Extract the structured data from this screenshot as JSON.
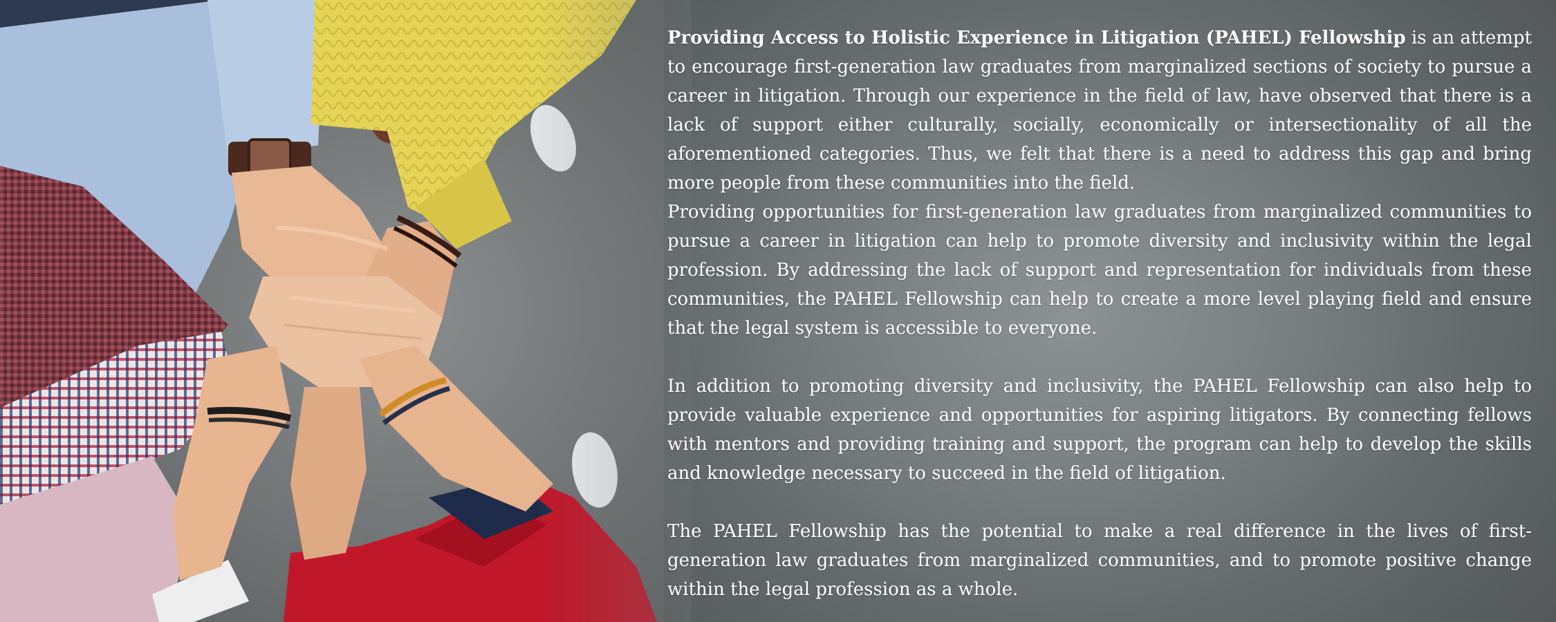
{
  "intro": {
    "title": "Providing Access to Holistic Experience in Litigation (PAHEL) Fellowship",
    "text": " is an attempt to encourage first-generation law graduates from marginalized sections of society to pursue a career in litigation. Through our experience in the field of law, have observed that there is a lack of support either culturally, socially, economically or intersectionality of all the aforementioned categories. Thus, we felt that there is a need to address this gap and bring more people from these communities into the field."
  },
  "paragraph_2": "Providing opportunities for first-generation law graduates from marginalized communities to pursue a career in litigation can help to promote diversity and inclusivity within the legal profession. By addressing the lack of support and representation for individuals from these communities, the PAHEL Fellowship can help to create a more level playing field and ensure that the legal system is accessible to everyone.",
  "paragraph_3": "In addition to promoting diversity and inclusivity, the PAHEL Fellowship can also help to provide valuable experience and opportunities for aspiring litigators. By connecting fellows with mentors and providing training and support, the program can help to develop the skills and knowledge necessary to succeed in the field of litigation.",
  "paragraph_4": "The PAHEL Fellowship has the potential to make a real difference in the lives of first-generation law graduates from marginalized communities, and to promote positive change within the legal profession as a whole.",
  "colors": {
    "text": "#ffffff",
    "background": "#7a7f81",
    "yellow_sleeve": "#e3d35a",
    "red_sleeve": "#c0182a",
    "blue_shirt": "#a9bfdc",
    "skin": "#e9b996"
  }
}
